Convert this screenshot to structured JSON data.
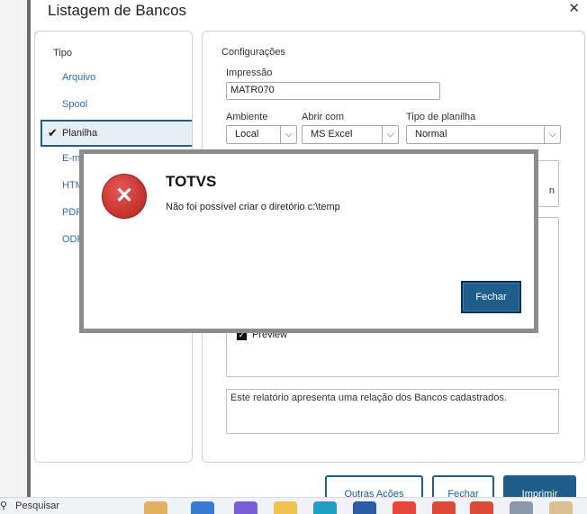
{
  "window": {
    "title": "Listagem de Bancos",
    "close_glyph": "✕"
  },
  "tipo": {
    "title": "Tipo",
    "items": [
      {
        "label": "Arquivo"
      },
      {
        "label": "Spool"
      },
      {
        "label": "Planilha",
        "selected": true
      },
      {
        "label": "E-mail"
      },
      {
        "label": "HTML"
      },
      {
        "label": "PDF"
      },
      {
        "label": "ODF"
      }
    ],
    "check_glyph": "✔"
  },
  "config": {
    "title": "Configurações",
    "impressao_label": "Impressão",
    "impressao_value": "MATR070",
    "ambiente_label": "Ambiente",
    "ambiente_value": "Local",
    "abrir_label": "Abrir com",
    "abrir_value": "MS Excel",
    "tipo_planilha_label": "Tipo de planilha",
    "tipo_planilha_value": "Normal",
    "upper_fragment": "n",
    "preview_label": "Preview",
    "description": "Este relatório apresenta uma relação dos Bancos cadastrados."
  },
  "buttons": {
    "outras_acoes": "Outras Ações",
    "fechar": "Fechar",
    "imprimir": "Imprimir"
  },
  "dialog": {
    "title": "TOTVS",
    "message": "Não foi possível criar o diretório c:\\temp",
    "button": "Fechar",
    "icon_glyph": "✕"
  },
  "taskbar": {
    "search_text": "Pesquisar"
  },
  "colors": {
    "accent": "#1f5e8c",
    "link": "#2f6eab",
    "error": "#c62828"
  }
}
